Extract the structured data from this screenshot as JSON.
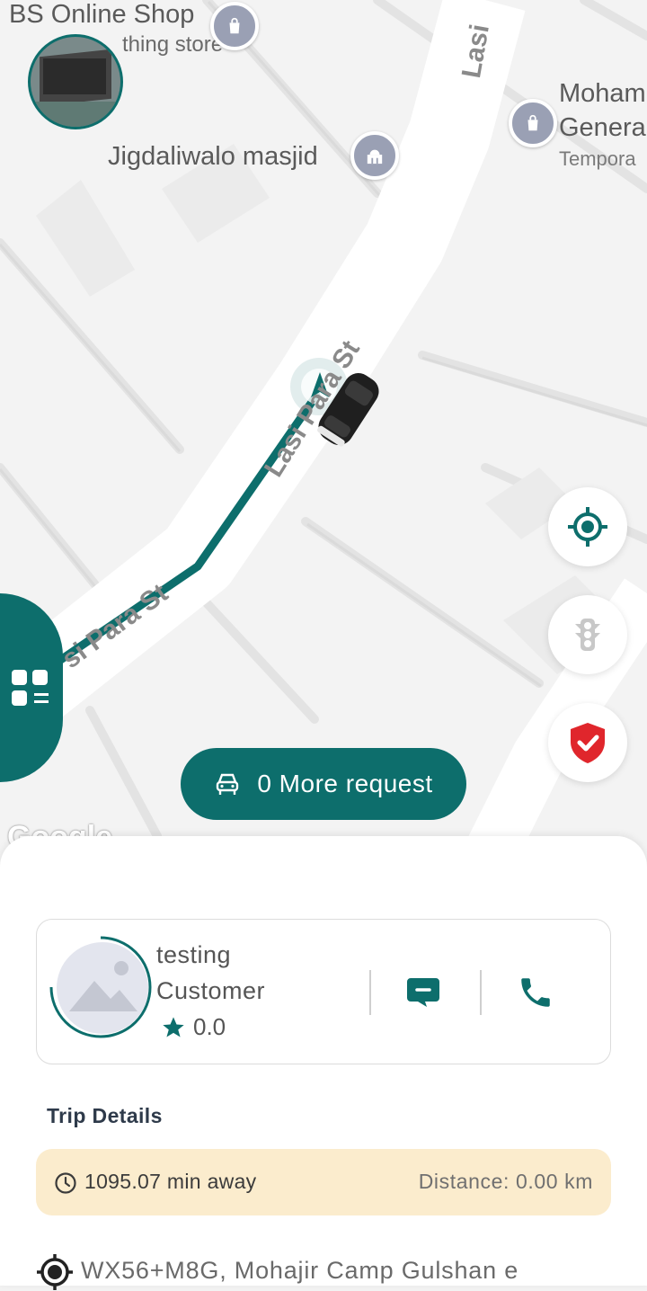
{
  "map": {
    "labels": {
      "shop_name": "BS Online Shop",
      "shop_sub": "thing store",
      "masjid": "Jigdaliwalo masjid",
      "store2_line1": "Moham",
      "store2_line2": "Genera",
      "store2_line3": "Tempora",
      "street_lasi_top": "Lasi",
      "street_lasi_mid": "Lasi Para St",
      "street_lasi_para": "si Para St",
      "google": "Google"
    },
    "route_color": "#0d6e6c"
  },
  "controls": {
    "locate_icon": "crosshair-icon",
    "traffic_icon": "traffic-light-icon",
    "safety_icon": "shield-check-icon",
    "menu_icon": "grid-menu-icon",
    "safety_color": "#e0262c"
  },
  "more_request": {
    "label": "0 More request",
    "icon": "car-icon"
  },
  "customer": {
    "name": "testing",
    "role": "Customer",
    "rating": "0.0",
    "message_icon": "chat-icon",
    "call_icon": "phone-icon",
    "accent": "#0d6e6c"
  },
  "trip": {
    "title": "Trip Details",
    "eta": "1095.07 min away",
    "distance": "Distance: 0.00 km",
    "pickup_address": "WX56+M8G, Mohajir Camp Gulshan e"
  }
}
